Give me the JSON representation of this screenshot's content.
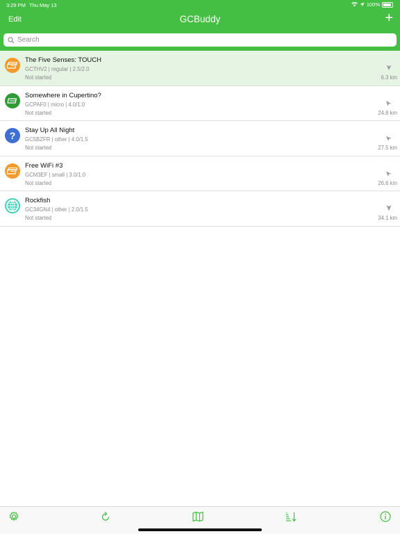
{
  "status_bar": {
    "time": "3:29 PM",
    "date": "Thu May 13",
    "battery": "100%"
  },
  "nav": {
    "edit_label": "Edit",
    "title": "GCBuddy",
    "add_label": "+"
  },
  "search": {
    "placeholder": "Search"
  },
  "colors": {
    "accent": "#45bf43",
    "selected_row": "#e6f5e3",
    "orange": "#f39a2a",
    "green": "#2e9b36",
    "blue": "#3e6fd1",
    "teal": "#3fd1b6"
  },
  "caches": [
    {
      "title": "The Five Senses: TOUCH",
      "meta": "GCTHV2 | regular | 2.5/2.0",
      "status": "Not started",
      "distance": "6.3 km",
      "icon": "traditional-cache-icon",
      "selected": true
    },
    {
      "title": "Somewhere in Cupertino?",
      "meta": "GCPAF0 | micro | 4.0/1.0",
      "status": "Not started",
      "distance": "24.8 km",
      "icon": "multi-cache-icon",
      "selected": false
    },
    {
      "title": "Stay Up All Night",
      "meta": "GC5BZFR | other | 4.0/1.5",
      "status": "Not started",
      "distance": "27.5 km",
      "icon": "mystery-cache-icon",
      "selected": false
    },
    {
      "title": "Free WiFi #3",
      "meta": "GCM3EF | small | 3.0/1.0",
      "status": "Not started",
      "distance": "26.6 km",
      "icon": "traditional-cache-icon",
      "selected": false
    },
    {
      "title": "Rockfish",
      "meta": "GC34GN4 | other | 2.0/1.5",
      "status": "Not started",
      "distance": "34.1 km",
      "icon": "earth-cache-icon",
      "selected": false
    }
  ],
  "toolbar": [
    "settings-gear-icon",
    "refresh-icon",
    "map-icon",
    "sort-icon",
    "info-icon"
  ]
}
